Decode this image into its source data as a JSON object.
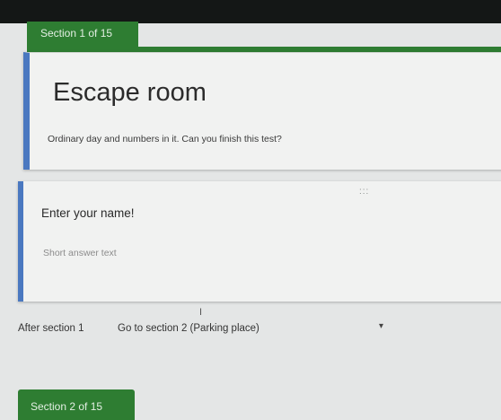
{
  "sections": {
    "first": "Section 1 of 15",
    "second": "Section 2 of 15"
  },
  "form": {
    "title": "Escape room",
    "description": "Ordinary day and numbers in it. Can you finish this test?"
  },
  "question": {
    "title": "Enter your name!",
    "answer_placeholder": "Short answer text",
    "drag_handle": ":::"
  },
  "navigation": {
    "after_label": "After section 1",
    "go_to_value": "Go to section 2 (Parking place)",
    "dropdown_arrow": "▾"
  },
  "cursor": "I",
  "colors": {
    "accent_green": "#2e7d32",
    "accent_blue": "#4a78c0"
  }
}
